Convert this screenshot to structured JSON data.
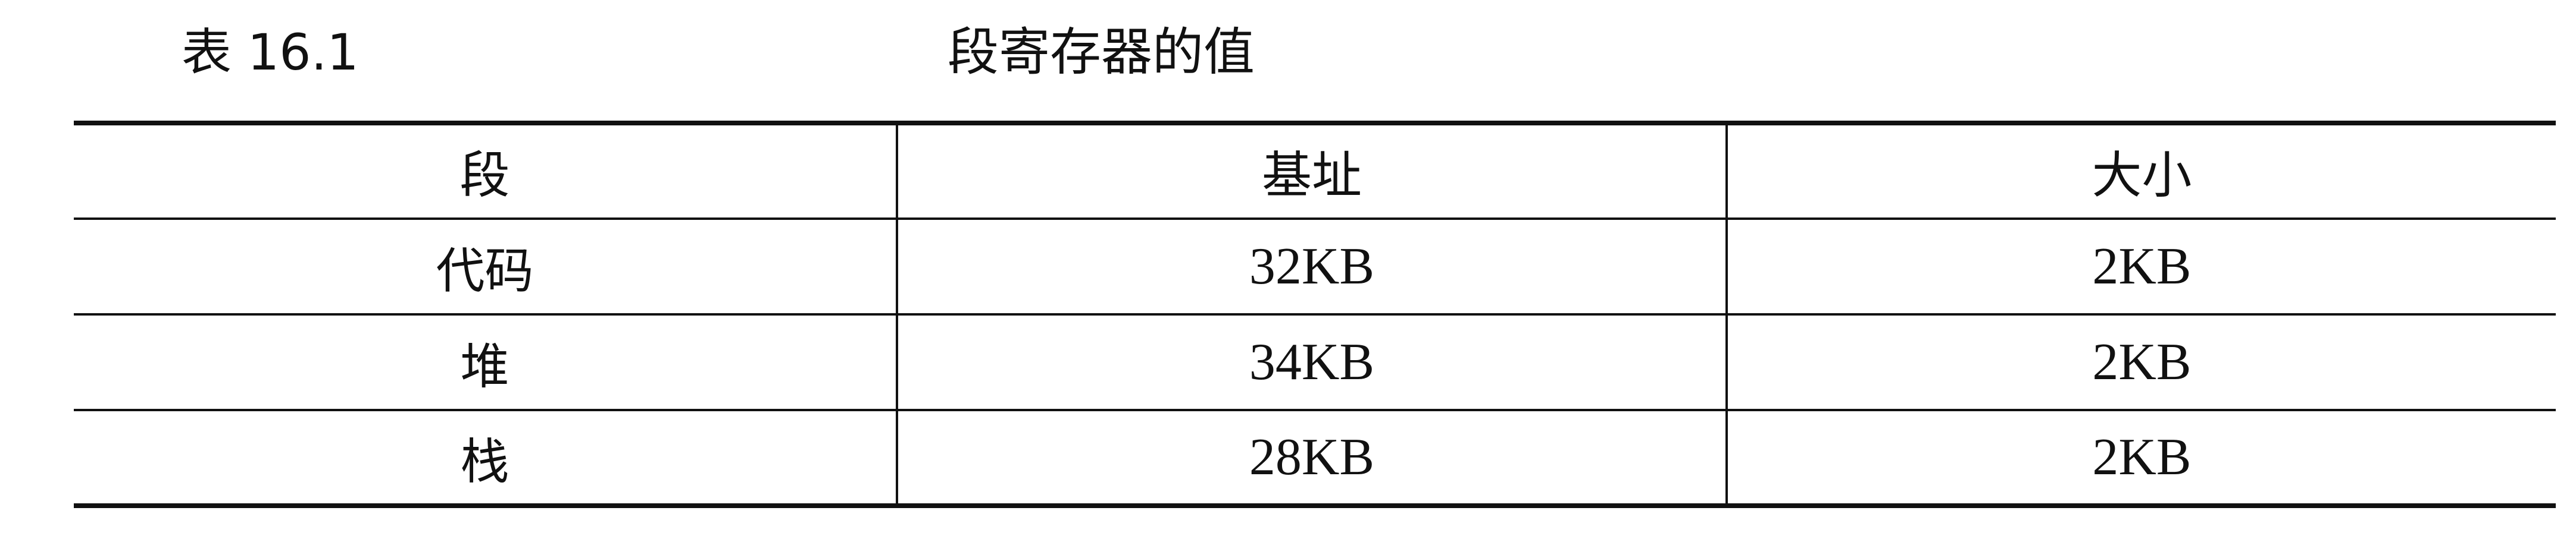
{
  "caption": {
    "label": "表 16.1",
    "title": "段寄存器的值"
  },
  "table": {
    "headers": [
      "段",
      "基址",
      "大小"
    ],
    "rows": [
      [
        "代码",
        "32KB",
        "2KB"
      ],
      [
        "堆",
        "34KB",
        "2KB"
      ],
      [
        "栈",
        "28KB",
        "2KB"
      ]
    ]
  }
}
